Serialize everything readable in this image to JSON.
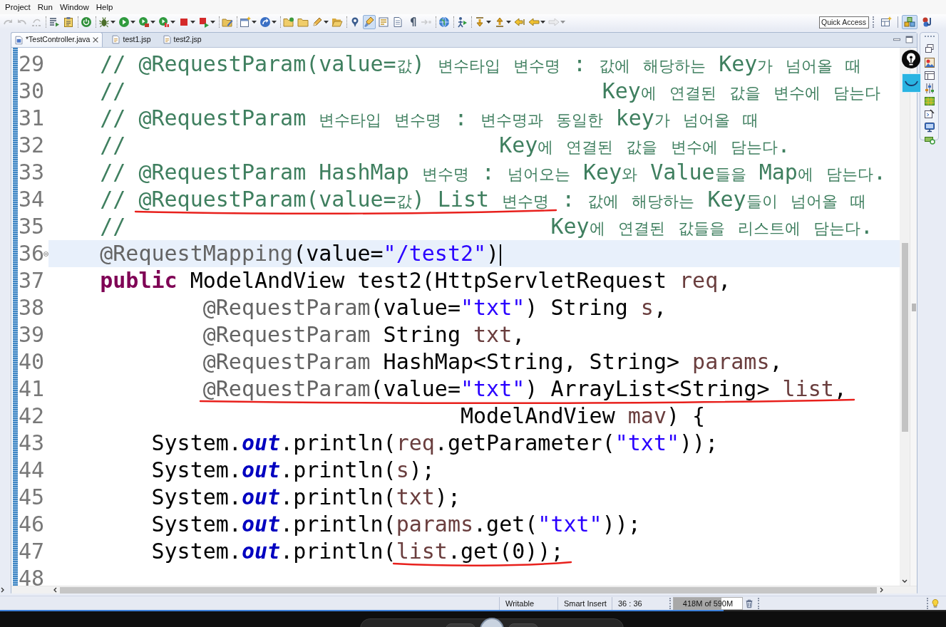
{
  "menus": [
    "Project",
    "Run",
    "Window",
    "Help"
  ],
  "toolbar": {
    "groups": [
      [
        {
          "disabled": true,
          "pressed": false,
          "menu": false
        },
        {
          "disabled": true,
          "pressed": false,
          "menu": false
        },
        {
          "disabled": true,
          "pressed": false,
          "menu": false
        }
      ],
      [
        {
          "disabled": false,
          "pressed": false,
          "menu": false
        },
        {
          "disabled": false,
          "pressed": false,
          "menu": false
        }
      ],
      [
        {
          "disabled": false,
          "pressed": false,
          "menu": false
        }
      ],
      [
        {
          "disabled": false,
          "pressed": false,
          "menu": true
        },
        {
          "disabled": false,
          "pressed": false,
          "menu": true
        },
        {
          "disabled": false,
          "pressed": false,
          "menu": true
        },
        {
          "disabled": false,
          "pressed": false,
          "menu": true
        },
        {
          "disabled": false,
          "pressed": false,
          "menu": true
        },
        {
          "disabled": false,
          "pressed": false,
          "menu": true
        }
      ],
      [
        {
          "disabled": false,
          "pressed": false,
          "menu": false
        }
      ],
      [
        {
          "disabled": false,
          "pressed": false,
          "menu": true
        },
        {
          "disabled": false,
          "pressed": false,
          "menu": true
        }
      ],
      [
        {
          "disabled": false,
          "pressed": false,
          "menu": false
        },
        {
          "disabled": false,
          "pressed": false,
          "menu": false
        },
        {
          "disabled": false,
          "pressed": false,
          "menu": true
        },
        {
          "disabled": false,
          "pressed": false,
          "menu": false
        }
      ],
      [
        {
          "disabled": false,
          "pressed": false,
          "menu": false
        },
        {
          "disabled": false,
          "pressed": true,
          "menu": false
        },
        {
          "disabled": false,
          "pressed": false,
          "menu": false
        },
        {
          "disabled": false,
          "pressed": false,
          "menu": false
        },
        {
          "disabled": false,
          "pressed": false,
          "menu": false
        },
        {
          "disabled": true,
          "pressed": false,
          "menu": false
        }
      ],
      [
        {
          "disabled": false,
          "pressed": false,
          "menu": false
        }
      ],
      [
        {
          "disabled": false,
          "pressed": false,
          "menu": false
        }
      ],
      [
        {
          "disabled": false,
          "pressed": false,
          "menu": true
        },
        {
          "disabled": false,
          "pressed": false,
          "menu": true
        },
        {
          "disabled": false,
          "pressed": false,
          "menu": false
        },
        {
          "disabled": false,
          "pressed": false,
          "menu": true
        },
        {
          "disabled": true,
          "pressed": false,
          "menu": true
        }
      ]
    ],
    "quick_access": {
      "placeholder": "Quick Access"
    },
    "perspectives": [
      {
        "selected": false
      },
      {
        "selected": true
      },
      {
        "selected": false
      }
    ]
  },
  "editor": {
    "tabs": [
      {
        "label": "*TestController.java",
        "kind": "java",
        "selected": true
      },
      {
        "label": "test1.jsp",
        "kind": "jsp",
        "selected": false
      },
      {
        "label": "test2.jsp",
        "kind": "jsp",
        "selected": false
      }
    ],
    "lines": [
      {
        "number": "29",
        "kind": "member",
        "current": false,
        "fold_marker": false,
        "tokens": [
          {
            "kind": "comment",
            "text": "// @RequestParam(value=값) 변수타입 변수명 : 값에 해당하는 Key가 넘어올 때"
          }
        ]
      },
      {
        "number": "30",
        "kind": "member",
        "current": false,
        "fold_marker": false,
        "tokens": [
          {
            "kind": "comment",
            "text": "//                                     Key에 연결된 값을 변수에 담는다"
          }
        ]
      },
      {
        "number": "31",
        "kind": "member",
        "current": false,
        "fold_marker": false,
        "tokens": [
          {
            "kind": "comment",
            "text": "// @RequestParam 변수타입 변수명 : 변수명과 동일한 key가 넘어올 때"
          }
        ]
      },
      {
        "number": "32",
        "kind": "member",
        "current": false,
        "fold_marker": false,
        "tokens": [
          {
            "kind": "comment",
            "text": "//                             Key에 연결된 값을 변수에 담는다."
          }
        ]
      },
      {
        "number": "33",
        "kind": "member",
        "current": false,
        "fold_marker": false,
        "tokens": [
          {
            "kind": "comment",
            "text": "// @RequestParam HashMap 변수명 : 넘어오는 Key와 Value들을 Map에 담는다."
          }
        ]
      },
      {
        "number": "34",
        "kind": "member",
        "current": false,
        "fold_marker": false,
        "tokens": [
          {
            "kind": "comment",
            "text": "// "
          },
          {
            "kind": "pen_mark",
            "tokens": [
              {
                "kind": "comment",
                "text": "@RequestParam(value=값) List 변수명"
              }
            ]
          },
          {
            "kind": "comment",
            "text": " : 값에 해당하는 Key들이 넘어올 때"
          }
        ]
      },
      {
        "number": "35",
        "kind": "member",
        "current": false,
        "fold_marker": false,
        "tokens": [
          {
            "kind": "comment",
            "text": "//                                 Key에 연결된 값들을 리스트에 담는다."
          }
        ]
      },
      {
        "number": "36",
        "kind": "member",
        "current": true,
        "fold_marker": true,
        "tokens": [
          {
            "kind": "annotation",
            "text": "@RequestMapping"
          },
          {
            "kind": "plain",
            "text": "(value="
          },
          {
            "kind": "string",
            "text": "\"/test2\""
          },
          {
            "kind": "plain",
            "text": ")"
          }
        ]
      },
      {
        "number": "37",
        "kind": "member",
        "current": false,
        "fold_marker": false,
        "tokens": [
          {
            "kind": "keyword",
            "text": "public"
          },
          {
            "kind": "plain",
            "text": " ModelAndView test2(HttpServletRequest "
          },
          {
            "kind": "var",
            "text": "req"
          },
          {
            "kind": "plain",
            "text": ","
          }
        ]
      },
      {
        "number": "38",
        "kind": "parameter",
        "current": false,
        "fold_marker": false,
        "tokens": [
          {
            "kind": "annotation",
            "text": "@RequestParam"
          },
          {
            "kind": "plain",
            "text": "(value="
          },
          {
            "kind": "string",
            "text": "\"txt\""
          },
          {
            "kind": "plain",
            "text": ") String "
          },
          {
            "kind": "var",
            "text": "s"
          },
          {
            "kind": "plain",
            "text": ","
          }
        ]
      },
      {
        "number": "39",
        "kind": "parameter",
        "current": false,
        "fold_marker": false,
        "tokens": [
          {
            "kind": "annotation",
            "text": "@RequestParam"
          },
          {
            "kind": "plain",
            "text": " String "
          },
          {
            "kind": "var",
            "text": "txt"
          },
          {
            "kind": "plain",
            "text": ","
          }
        ]
      },
      {
        "number": "40",
        "kind": "parameter",
        "current": false,
        "fold_marker": false,
        "tokens": [
          {
            "kind": "annotation",
            "text": "@RequestParam"
          },
          {
            "kind": "plain",
            "text": " HashMap<String, String> "
          },
          {
            "kind": "var",
            "text": "params"
          },
          {
            "kind": "plain",
            "text": ","
          }
        ]
      },
      {
        "number": "41",
        "kind": "parameter",
        "current": false,
        "fold_marker": false,
        "tokens": [
          {
            "kind": "pen_mark",
            "tokens": [
              {
                "kind": "annotation",
                "text": "@RequestParam"
              },
              {
                "kind": "plain",
                "text": "(value="
              },
              {
                "kind": "string",
                "text": "\"txt\""
              },
              {
                "kind": "plain",
                "text": ") ArrayList<String> "
              },
              {
                "kind": "var",
                "text": "list"
              },
              {
                "kind": "plain",
                "text": ","
              }
            ]
          }
        ]
      },
      {
        "number": "42",
        "kind": "continuation",
        "current": false,
        "fold_marker": false,
        "tokens": [
          {
            "kind": "plain",
            "text": "ModelAndView "
          },
          {
            "kind": "var",
            "text": "mav"
          },
          {
            "kind": "plain",
            "text": ") {"
          }
        ]
      },
      {
        "number": "43",
        "kind": "statement",
        "current": false,
        "fold_marker": false,
        "tokens": [
          {
            "kind": "plain",
            "text": "System."
          },
          {
            "kind": "field",
            "text": "out"
          },
          {
            "kind": "plain",
            "text": ".println("
          },
          {
            "kind": "var",
            "text": "req"
          },
          {
            "kind": "plain",
            "text": ".getParameter("
          },
          {
            "kind": "string",
            "text": "\"txt\""
          },
          {
            "kind": "plain",
            "text": "));"
          }
        ]
      },
      {
        "number": "44",
        "kind": "statement",
        "current": false,
        "fold_marker": false,
        "tokens": [
          {
            "kind": "plain",
            "text": "System."
          },
          {
            "kind": "field",
            "text": "out"
          },
          {
            "kind": "plain",
            "text": ".println("
          },
          {
            "kind": "var",
            "text": "s"
          },
          {
            "kind": "plain",
            "text": ");"
          }
        ]
      },
      {
        "number": "45",
        "kind": "statement",
        "current": false,
        "fold_marker": false,
        "tokens": [
          {
            "kind": "plain",
            "text": "System."
          },
          {
            "kind": "field",
            "text": "out"
          },
          {
            "kind": "plain",
            "text": ".println("
          },
          {
            "kind": "var",
            "text": "txt"
          },
          {
            "kind": "plain",
            "text": ");"
          }
        ]
      },
      {
        "number": "46",
        "kind": "statement",
        "current": false,
        "fold_marker": false,
        "tokens": [
          {
            "kind": "plain",
            "text": "System."
          },
          {
            "kind": "field",
            "text": "out"
          },
          {
            "kind": "plain",
            "text": ".println("
          },
          {
            "kind": "var",
            "text": "params"
          },
          {
            "kind": "plain",
            "text": ".get("
          },
          {
            "kind": "string",
            "text": "\"txt\""
          },
          {
            "kind": "plain",
            "text": "));"
          }
        ]
      },
      {
        "number": "47",
        "kind": "statement",
        "current": false,
        "fold_marker": false,
        "tokens": [
          {
            "kind": "plain",
            "text": "System."
          },
          {
            "kind": "field",
            "text": "out"
          },
          {
            "kind": "plain",
            "text": ".println("
          },
          {
            "kind": "pen_mark",
            "tokens": [
              {
                "kind": "var",
                "text": "list"
              },
              {
                "kind": "plain",
                "text": ".get(0));"
              }
            ]
          }
        ]
      },
      {
        "number": "48",
        "kind": "statement",
        "current": false,
        "fold_marker": false
      }
    ]
  },
  "status_bar": {
    "items": [
      "Writable",
      "Smart Insert",
      "36 : 36"
    ],
    "heap": {
      "reading": "418M of 590M",
      "level": 0.7
    }
  },
  "player": {
    "progress": {
      "level": 0.765
    }
  }
}
